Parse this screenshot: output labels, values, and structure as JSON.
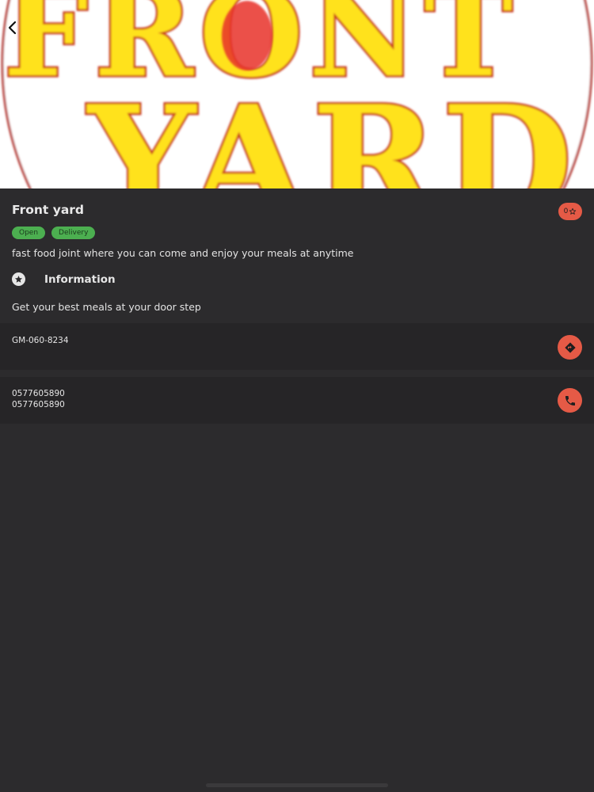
{
  "header": {
    "logo_text_line1": "FRONT",
    "logo_text_line2": "YARD",
    "back_icon": "chevron-left-icon"
  },
  "restaurant": {
    "name": "Front yard",
    "rating": "0",
    "rating_icon": "star-outline-icon",
    "tags": [
      "Open",
      "Delivery"
    ],
    "description": "fast food joint where you can come and enjoy your meals at anytime"
  },
  "information": {
    "title": "Information",
    "icon": "star-circle-icon",
    "text": "Get your best meals at your door step"
  },
  "address": {
    "code": "GM-060-8234",
    "action_icon": "directions-icon"
  },
  "phone": {
    "number1": "0577605890",
    "number2": "0577605890",
    "action_icon": "phone-icon"
  },
  "colors": {
    "accent": "#e55a46",
    "tag_green": "#4caf50",
    "background": "#2c2b2d",
    "card": "#262527"
  }
}
